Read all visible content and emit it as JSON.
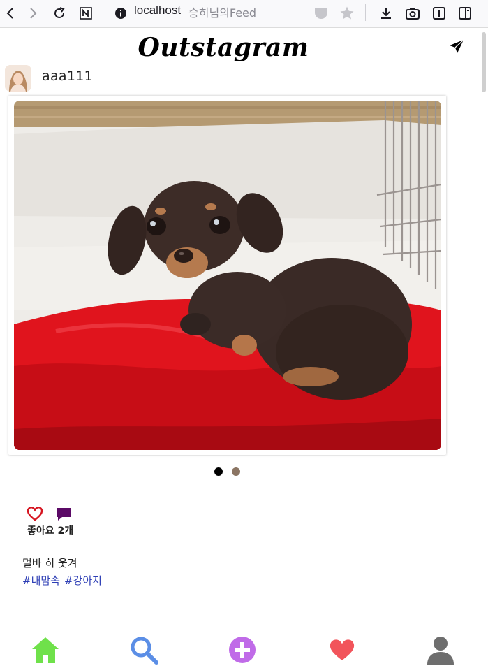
{
  "browser": {
    "url_host": "localhost",
    "tab_title": "승히님의Feed",
    "icons": [
      "back-icon",
      "forward-icon",
      "reload-icon",
      "notion-icon",
      "info-icon",
      "pocket-icon",
      "bookmark-star-icon",
      "download-icon",
      "screenshot-icon",
      "reader-icon",
      "sidebar-icon"
    ]
  },
  "header": {
    "logo": "Outstagram",
    "direct_icon": "paper-plane-icon"
  },
  "post": {
    "username": "aaa111",
    "image": "dachshund puppy on red cushion",
    "carousel": {
      "total": 2,
      "active": 1
    },
    "likes_label": "좋아요 2개",
    "caption": "멀바 히 웃겨",
    "hashtags": [
      "#내맘속",
      "#강아지"
    ]
  },
  "bottom_nav": {
    "items": [
      "home-icon",
      "search-icon",
      "add-post-icon",
      "activity-heart-icon",
      "profile-icon"
    ]
  },
  "colors": {
    "home": "#6fe14a",
    "search": "#5b8ee6",
    "add": "#c06be8",
    "heart": "#f2545b",
    "profile": "#6e6e6e",
    "hashtag": "#2d3eb5",
    "comment": "#5b0a66"
  }
}
